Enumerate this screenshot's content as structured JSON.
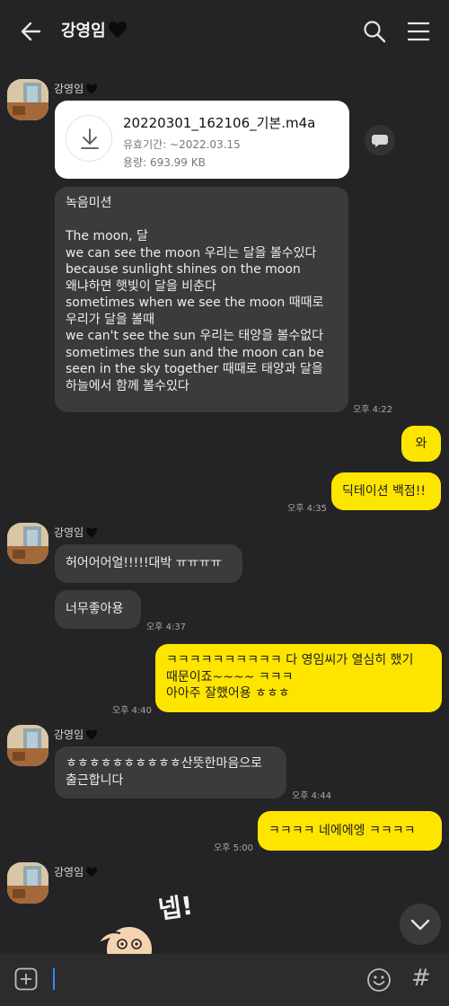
{
  "header": {
    "title": "강영임",
    "back_icon": "arrow-left-icon",
    "search_icon": "search-icon",
    "menu_icon": "hamburger-menu-icon"
  },
  "messages": {
    "sender_name": "강영임",
    "file": {
      "name": "20220301_162106_기본.m4a",
      "expiry": "유효기간: ~2022.03.15",
      "size": "용량: 693.99 KB"
    },
    "m1": {
      "lines": [
        "녹음미션",
        "",
        "The moon, 달",
        "we can see the moon 우리는 달을 볼수있다",
        "because sunlight shines on the moon",
        "왜냐하면 햇빛이 달을 비춘다",
        "sometimes when we see the moon 때때로",
        "우리가 달을 볼때",
        "we can't see the sun 우리는 태양을 볼수없다",
        "sometimes the sun and the moon can be",
        "seen in the sky together 때때로 태양과 달을",
        "하늘에서 함께 볼수있다"
      ],
      "time": "오후 4:22"
    },
    "o1": {
      "text": "와"
    },
    "o2": {
      "text": "딕테이션 백점!!",
      "time": "오후 4:35"
    },
    "m2": {
      "text": "허어어어얼!!!!!대박 ㅠㅠㅠㅠ"
    },
    "m3": {
      "text": "너무좋아용",
      "time": "오후 4:37"
    },
    "o3": {
      "lines": [
        "ㅋㅋㅋㅋㅋㅋㅋㅋㅋㅋ 다 영임씨가 열심히 했기",
        "때문이죠~~~~ ㅋㅋㅋ",
        "아아주 잘했어용 ㅎㅎㅎ"
      ],
      "time": "오후 4:40"
    },
    "m4": {
      "lines": [
        "ㅎㅎㅎㅎㅎㅎㅎㅎㅎㅎ산뜻한마음으로",
        "출근합니다"
      ],
      "time": "오후 4:44"
    },
    "o4": {
      "text": "ㅋㅋㅋㅋ 네에에엥 ㅋㅋㅋㅋ",
      "time": "오후 5:00"
    },
    "sticker_text": "넵!"
  },
  "input": {
    "value": ""
  },
  "colors": {
    "background": "#242427",
    "incoming": "#3b3b3e",
    "outgoing": "#fee500",
    "accent_cursor": "#2d8cff"
  }
}
